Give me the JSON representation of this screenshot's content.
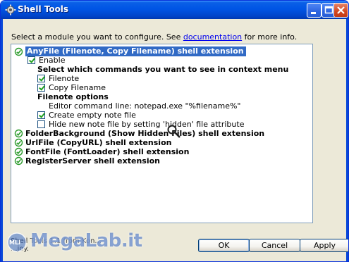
{
  "window": {
    "title": "Shell Tools"
  },
  "instruction": {
    "prefix": "Select a module you want to configure. See ",
    "link": "documentation",
    "suffix": " for more info."
  },
  "tree": {
    "modules": [
      {
        "label": "AnyFile (Filenote, Copy Filename) shell extension",
        "selected": true
      },
      {
        "label": "FolderBackground (Show Hidden Files) shell extension"
      },
      {
        "label": "UrlFile (CopyURL) shell extension"
      },
      {
        "label": "FontFile (FontLoader) shell extension"
      },
      {
        "label": "RegisterServer shell extension"
      }
    ],
    "anyfile": {
      "enable_label": "Enable",
      "enable_checked": true,
      "commands_heading": "Select which commands you want to see in context menu",
      "filenote_label": "Filenote",
      "filenote_checked": true,
      "copyfilename_label": "Copy Filename",
      "copyfilename_checked": true,
      "options_heading": "Filenote options",
      "editor_line": "Editor command line: notepad.exe \"%filename%\"",
      "create_empty_label": "Create empty note file",
      "create_empty_checked": true,
      "hide_note_label": "Hide new note file by setting 'hidden' file attribute",
      "hide_note_checked": false
    }
  },
  "footer": {
    "line1": "Shell Tools 1.1 from Kon...",
    "line2": "...joy."
  },
  "buttons": {
    "ok": "OK",
    "cancel": "Cancel",
    "apply": "Apply"
  },
  "watermark": {
    "text": "MegaLab.it",
    "badge": "MLI"
  },
  "colors": {
    "titlebar": "#0055e5",
    "selection": "#316ac5",
    "checkmark": "#21a121",
    "window_bg": "#ece9d8"
  }
}
